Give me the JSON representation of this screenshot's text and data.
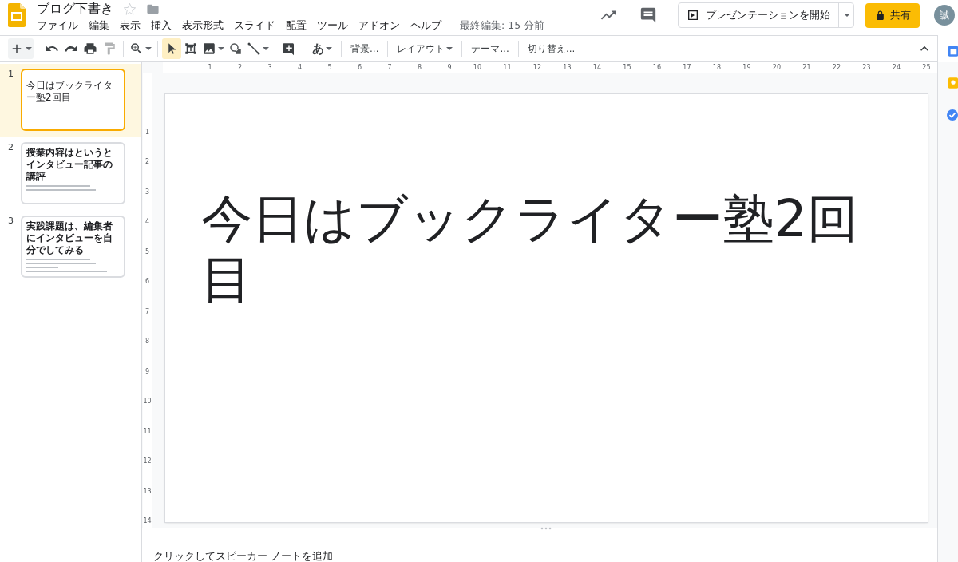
{
  "document": {
    "title": "ブログ下書き",
    "starred": false
  },
  "menu": [
    "ファイル",
    "編集",
    "表示",
    "挿入",
    "表示形式",
    "スライド",
    "配置",
    "ツール",
    "アドオン",
    "ヘルプ"
  ],
  "last_edit": "最終編集: 15 分前",
  "present_button": "プレゼンテーションを開始",
  "share_button": "共有",
  "avatar": "誠",
  "tools": [
    {
      "selected": false
    },
    {
      "selected": false
    },
    {
      "selected": false
    },
    {
      "selected": false
    },
    {
      "selected": false
    },
    {
      "selected": false
    },
    {
      "selected": true
    },
    {
      "selected": false
    },
    {
      "selected": false
    },
    {
      "selected": false
    },
    {
      "selected": false
    },
    {
      "selected": false
    }
  ],
  "toolbar_labels": [
    "あ",
    "背景...",
    "レイアウト",
    "テーマ...",
    "切り替え..."
  ],
  "slides": [
    {
      "number": "1",
      "title": "今日はブックライター塾2回目",
      "selected": true
    },
    {
      "number": "2",
      "title": "授業内容はというとインタビュー記事の講評",
      "selected": false
    },
    {
      "number": "3",
      "title": "実践課題は、編集者にインタビューを自分でしてみる",
      "selected": false
    }
  ],
  "ruler": {
    "horizontal": [
      "1",
      "2",
      "3",
      "4",
      "5",
      "6",
      "7",
      "8",
      "9",
      "10",
      "11",
      "12",
      "13",
      "14",
      "15",
      "16",
      "17",
      "18",
      "19",
      "20",
      "21",
      "22",
      "23",
      "24",
      "25"
    ],
    "vertical": [
      "1",
      "2",
      "3",
      "4",
      "5",
      "6",
      "7",
      "8",
      "9",
      "10",
      "11",
      "12",
      "13",
      "14"
    ]
  },
  "slide": {
    "title": "今日はブックライター塾2回目"
  },
  "speaker_notes": {
    "placeholder": "クリックしてスピーカー ノートを追加"
  }
}
